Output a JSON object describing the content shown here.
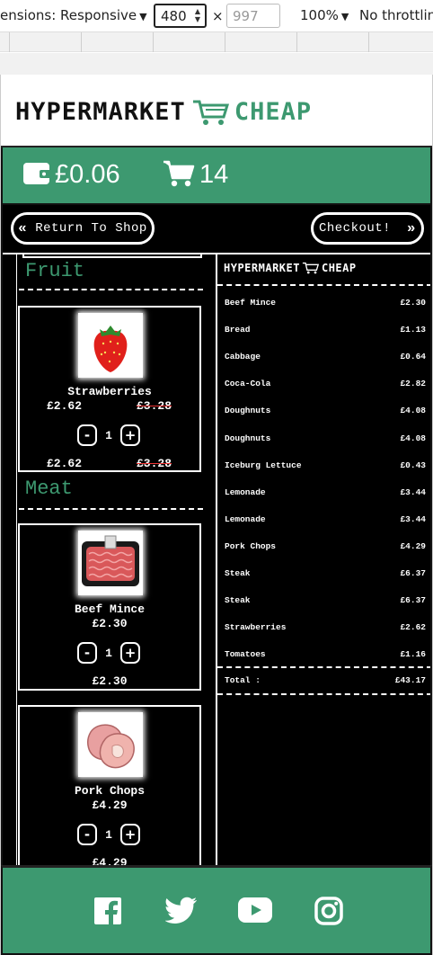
{
  "devtools": {
    "dimensions_label": "ensions: Responsive",
    "width": "480",
    "height_placeholder": "997",
    "times": "×",
    "zoom": "100%",
    "throttling": "No throttling"
  },
  "header": {
    "logo_part1": "HYPERMARKET",
    "logo_part2": "CHEAP",
    "brand_color": "#3d9970"
  },
  "stats": {
    "money": "£0.06",
    "cart_count": "14"
  },
  "nav": {
    "return_label": "Return To Shop",
    "checkout_label": "Checkout!"
  },
  "categories": [
    {
      "title": "Fruit"
    },
    {
      "title": "Meat"
    }
  ],
  "products": [
    {
      "name": "Strawberries",
      "price": "£2.62",
      "was": "£3.28",
      "qty": "1",
      "total": "£2.62",
      "total_was": "£3.28"
    },
    {
      "name": "Beef Mince",
      "price": "£2.30",
      "qty": "1",
      "total": "£2.30"
    },
    {
      "name": "Pork Chops",
      "price": "£4.29",
      "qty": "1",
      "total": "£4.29"
    }
  ],
  "receipt": {
    "logo_part1": "HYPERMARKET",
    "logo_part2": "CHEAP",
    "items": [
      {
        "name": "Beef Mince",
        "price": "£2.30"
      },
      {
        "name": "Bread",
        "price": "£1.13"
      },
      {
        "name": "Cabbage",
        "price": "£0.64"
      },
      {
        "name": "Coca-Cola",
        "price": "£2.82"
      },
      {
        "name": "Doughnuts",
        "price": "£4.08"
      },
      {
        "name": "Doughnuts",
        "price": "£4.08"
      },
      {
        "name": "Iceburg Lettuce",
        "price": "£0.43"
      },
      {
        "name": "Lemonade",
        "price": "£3.44"
      },
      {
        "name": "Lemonade",
        "price": "£3.44"
      },
      {
        "name": "Pork Chops",
        "price": "£4.29"
      },
      {
        "name": "Steak",
        "price": "£6.37"
      },
      {
        "name": "Steak",
        "price": "£6.37"
      },
      {
        "name": "Strawberries",
        "price": "£2.62"
      },
      {
        "name": "Tomatoes",
        "price": "£1.16"
      }
    ],
    "total_label": "Total :",
    "total_value": "£43.17"
  },
  "footer": {
    "icons": [
      "facebook-icon",
      "twitter-icon",
      "youtube-icon",
      "instagram-icon"
    ]
  }
}
